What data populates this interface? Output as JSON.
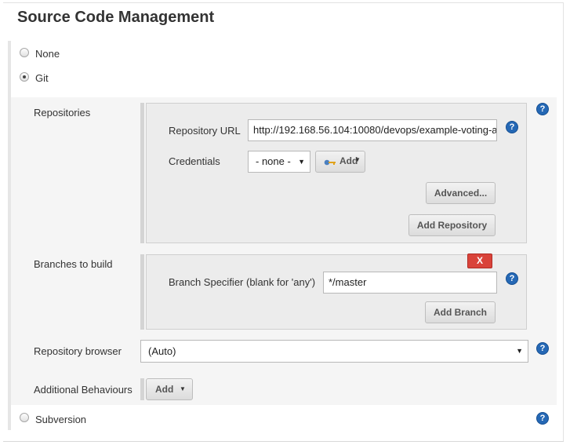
{
  "section": {
    "title": "Source Code Management"
  },
  "scm_options": {
    "none": {
      "label": "None",
      "selected": false
    },
    "git": {
      "label": "Git",
      "selected": true
    },
    "subversion": {
      "label": "Subversion",
      "selected": false
    }
  },
  "repositories": {
    "label": "Repositories",
    "url_label": "Repository URL",
    "url_value": "http://192.168.56.104:10080/devops/example-voting-a",
    "credentials_label": "Credentials",
    "credentials_value": "- none -",
    "add_credentials_button": "Add",
    "advanced_button": "Advanced...",
    "add_repository_button": "Add Repository"
  },
  "branches": {
    "label": "Branches to build",
    "delete_button": "X",
    "specifier_label": "Branch Specifier (blank for 'any')",
    "specifier_value": "*/master",
    "add_branch_button": "Add Branch"
  },
  "repository_browser": {
    "label": "Repository browser",
    "value": "(Auto)"
  },
  "additional_behaviours": {
    "label": "Additional Behaviours",
    "add_button": "Add"
  },
  "help": {
    "glyph": "?"
  },
  "colors": {
    "help_blue": "#2568b5",
    "delete_red": "#d9433a"
  }
}
